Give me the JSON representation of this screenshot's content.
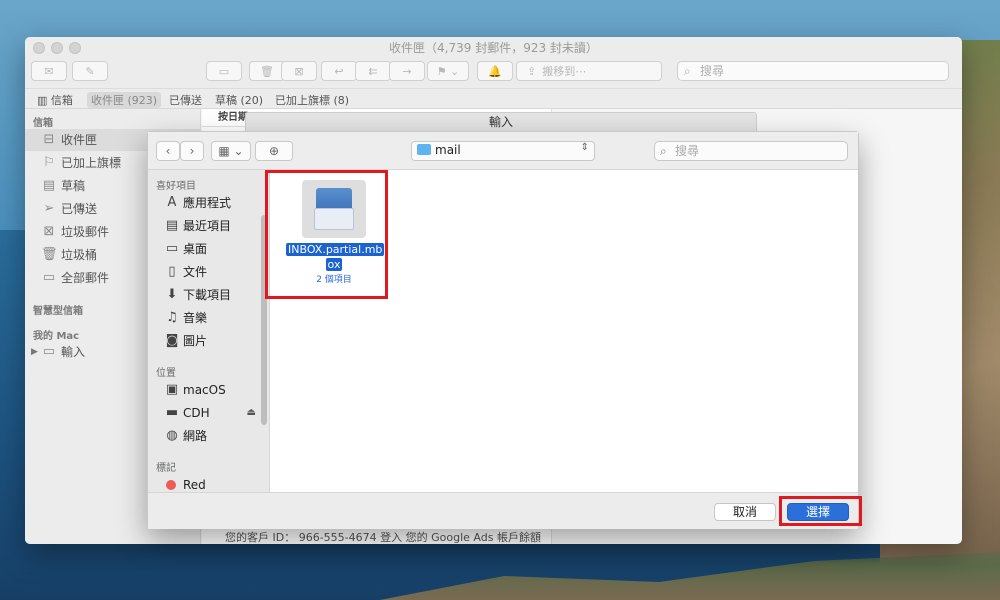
{
  "mail": {
    "window_title": "收件匣（4,739 封郵件，923 封未讀）",
    "toolbar": {
      "move_to": "搬移到⋯",
      "search_placeholder": "搜尋"
    },
    "favorites": {
      "mailboxes": "信箱",
      "inbox": "收件匣 (923)",
      "sent": "已傳送",
      "drafts": "草稿 (20)",
      "flagged": "已加上旗標 (8)"
    },
    "sidebar": {
      "section_mailboxes": "信箱",
      "items": [
        {
          "label": "收件匣",
          "icon": "inbox-icon"
        },
        {
          "label": "已加上旗標",
          "icon": "flag-icon"
        },
        {
          "label": "草稿",
          "icon": "document-icon"
        },
        {
          "label": "已傳送",
          "icon": "paper-plane-icon"
        },
        {
          "label": "垃圾郵件",
          "icon": "junk-icon"
        },
        {
          "label": "垃圾桶",
          "icon": "trash-icon"
        },
        {
          "label": "全部郵件",
          "icon": "archive-icon"
        }
      ],
      "section_smart": "智慧型信箱",
      "section_mymac": "我的 Mac",
      "mymac_item": "輸入"
    },
    "list": {
      "sort_header": "按日期"
    },
    "footer_text": "您的客戶 ID： 966-555-4674 登入 您的 Google Ads 帳戶餘額"
  },
  "import_sheet": {
    "title": "輸入"
  },
  "dialog": {
    "path": "mail",
    "search_placeholder": "搜尋",
    "favorites_head": "喜好項目",
    "favorites": [
      {
        "label": "應用程式",
        "icon": "applications-icon"
      },
      {
        "label": "最近項目",
        "icon": "recents-icon"
      },
      {
        "label": "桌面",
        "icon": "desktop-icon"
      },
      {
        "label": "文件",
        "icon": "documents-icon"
      },
      {
        "label": "下載項目",
        "icon": "downloads-icon"
      },
      {
        "label": "音樂",
        "icon": "music-icon"
      },
      {
        "label": "圖片",
        "icon": "pictures-icon"
      }
    ],
    "locations_head": "位置",
    "locations": [
      {
        "label": "macOS",
        "icon": "disk-icon"
      },
      {
        "label": "CDH",
        "icon": "external-disk-icon"
      },
      {
        "label": "網路",
        "icon": "network-icon"
      }
    ],
    "tags_head": "標記",
    "tags": [
      {
        "label": "Red",
        "color": "#ec5b57"
      }
    ],
    "file": {
      "name_line1": "INBOX.partial.mb",
      "name_line2": "ox",
      "meta": "2 個項目"
    },
    "cancel_label": "取消",
    "choose_label": "選擇"
  },
  "colors": {
    "accent": "#2b6fd9",
    "highlight": "#e0191f"
  }
}
